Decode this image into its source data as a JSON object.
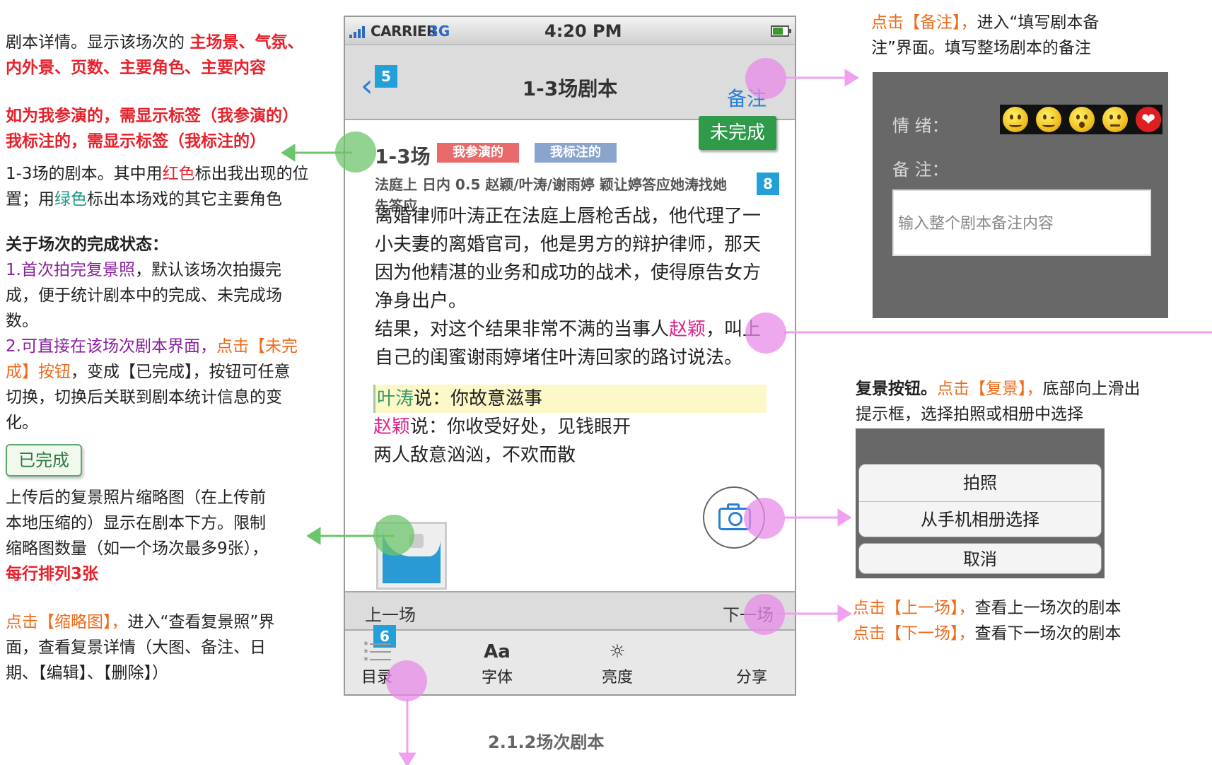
{
  "left_annotations": {
    "detail_prefix": "剧本详情。显示该场次的",
    "detail_fields_line1": "主场景、气氛、",
    "detail_fields_line2": "内外景、页数、主要角色、主要内容",
    "tags_line1": "如为我参演的，需显示标签（我参演的）",
    "tags_line2": "我标注的，需显示标签（我标注的）",
    "script_line1_a": "1-3场的剧本。其中用",
    "script_line1_red": "红色",
    "script_line1_b": "标出我出现的位",
    "script_line2_a": "置；用",
    "script_line2_green": "绿色",
    "script_line2_b": "标出本场戏的其它主要角色",
    "status_title": "关于场次的完成状态：",
    "status_1_a": "1.首次拍完复景照",
    "status_1_b": "，默认该场次拍摄完",
    "status_1_c": "成，便于统计剧本中的完成、未完成场",
    "status_1_d": "数。",
    "status_2_a": "2.可直接在该场次剧本界面，",
    "status_2_b": "点击【未完",
    "status_2_c": "成】按钮",
    "status_2_d": "，变成【已完成】，按钮可任意",
    "status_2_e": "切换，切换后关联到剧本统计信息的变",
    "status_2_f": "化。",
    "done_button_sample": "已完成",
    "thumb_line1": "上传后的复景照片缩略图（在上传前",
    "thumb_line2": "本地压缩的）显示在剧本下方。限制",
    "thumb_line3": "缩略图数量（如一个场次最多9张），",
    "thumb_line4": "每行排列3张",
    "thumb_click_a": "点击【缩略图】，",
    "thumb_click_b": "进入“查看复景照”界",
    "thumb_click_c": "面，查看复景详情（大图、备注、日",
    "thumb_click_d": "期、【编辑】、【删除】）"
  },
  "phone": {
    "status_bar": {
      "carrier": "CARRIER",
      "network": "3G",
      "time": "4:20 PM"
    },
    "nav": {
      "title": "1-3场剧本",
      "note_button": "备注",
      "back_icon": "chevron-left-icon",
      "badge": "5"
    },
    "scene": {
      "number": "1-3场",
      "tag_acting": "我参演的",
      "tag_marked": "我标注的",
      "status_button": "未完成",
      "info_line1": "法庭上  日内  0.5  赵颖/叶涛/谢雨婷  颖让婷答应她涛找她",
      "info_line2": "先答应",
      "badge": "8"
    },
    "script": {
      "p1": "离婚律师叶涛正在法庭上唇枪舌战，他代理了一小夫妻的离婚官司，他是男方的辩护律师，那天因为他精湛的业务和成功的战术，使得原告女方净身出户。",
      "p2_a": "结果，对这个结果非常不满的当事人",
      "p2_name": "赵颖",
      "p2_b": "，叫上自己的闺蜜谢雨婷堵住叶涛回家的路讨说法。",
      "d1_name": "叶涛",
      "d1_text": "说：你故意滋事",
      "d2_name": "赵颖",
      "d2_text": "说：你收受好处，见钱眼开",
      "d3_text": "两人敌意汹汹，不欢而散"
    },
    "camera_icon": "camera-icon",
    "prev_label": "上一场",
    "next_label": "下一场",
    "tabbar": {
      "badge": "6",
      "items": [
        {
          "label": "目录",
          "icon": "list-icon"
        },
        {
          "label": "字体",
          "icon": "Aa"
        },
        {
          "label": "亮度",
          "icon": "sun-icon"
        },
        {
          "label": "分享",
          "icon": "share-icon"
        }
      ]
    }
  },
  "right_annotations": {
    "note_a": "点击【备注】，",
    "note_b": "进入“填写剧本备",
    "note_c": "注”界面。填写整场剧本的备注",
    "note_panel": {
      "mood_label": "情      绪：",
      "note_label": "备      注：",
      "input_placeholder": "输入整个剧本备注内容"
    },
    "photo_a": "复景按钮。",
    "photo_b": "点击【复景】，",
    "photo_c": "底部向上滑出",
    "photo_d": "提示框，选择拍照或相册中选择",
    "sheet": {
      "take_photo": "拍照",
      "from_album": "从手机相册选择",
      "cancel": "取消"
    },
    "prev_a": "点击【上一场】，",
    "prev_b": "查看上一场次的剧本",
    "next_a": "点击【下一场】，",
    "next_b": "查看下一场次的剧本"
  },
  "caption": "2.1.2场次剧本",
  "colors": {
    "accent_blue": "#2a7fd4",
    "done_green": "#2e9a4a",
    "tag_red": "#e86a6a",
    "tag_blue": "#8aa4cc",
    "pink_connector": "#f0a0f0",
    "green_connector": "#6cc46c"
  }
}
